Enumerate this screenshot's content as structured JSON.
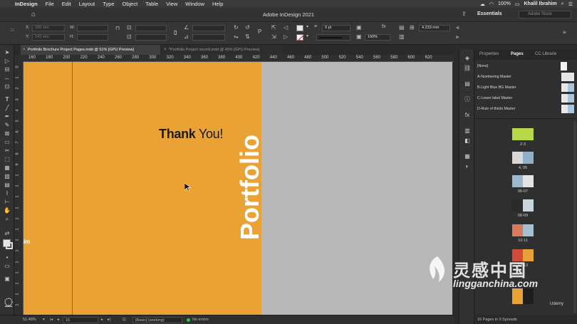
{
  "menubar": {
    "app_name": "InDesign",
    "items": [
      "File",
      "Edit",
      "Layout",
      "Type",
      "Object",
      "Table",
      "View",
      "Window",
      "Help"
    ],
    "battery": "100%",
    "user": "Khalil Ibrahim"
  },
  "appbar": {
    "title": "Adobe InDesign 2021",
    "workspace": "Essentials",
    "search_placeholder": "Adobe Stock"
  },
  "control": {
    "x_label": "X:",
    "x_value": "335 mm",
    "y_label": "Y:",
    "y_value": "143 mm",
    "w_label": "W:",
    "h_label": "H:",
    "stroke_weight": "0 pt",
    "opacity": "100%",
    "gap": "4.233 mm"
  },
  "tabs": [
    {
      "label": "Portfolio Brochure Project Pages.indd @ 51% [GPU Preview]",
      "active": true
    },
    {
      "label": "*Portfolio Project record.indd @ 45% [GPU Preview]",
      "active": false
    }
  ],
  "ruler": {
    "h_ticks": [
      "160",
      "180",
      "200",
      "220",
      "240",
      "260",
      "280",
      "300",
      "320",
      "340",
      "360",
      "380",
      "400",
      "420",
      "440",
      "460",
      "480",
      "500",
      "520",
      "540",
      "560",
      "580",
      "600",
      "620"
    ],
    "v_ticks": [
      "0",
      "1",
      "2",
      "3",
      "4",
      "5",
      "6",
      "7",
      "8",
      "9",
      "1",
      "1",
      "1",
      "1",
      "1",
      "1",
      "1",
      "1",
      "1",
      "1",
      "1",
      "1",
      "1"
    ]
  },
  "canvas": {
    "headline_bold": "Thank",
    "headline_regular": "You!",
    "vertical_text": "Portfolio",
    "side_label": "im"
  },
  "status": {
    "zoom": "51.48%",
    "page": "15",
    "style": "[Basic] (working)",
    "preflight": "No errors"
  },
  "panel": {
    "tabs": [
      "Properties",
      "Pages",
      "CC Librarie"
    ],
    "active_tab": "Pages",
    "masters": [
      "[None]",
      "A-Numbering Master",
      "B-Light Blue BG Master",
      "C-Lower label Master",
      "D-Rule of thirds Master"
    ],
    "spreads": [
      "2-3",
      "4, 05",
      "06-07",
      "08-09",
      "10-11",
      "12-13"
    ],
    "footer": "16 Pages in 9 Spreads"
  },
  "watermark": {
    "cn": "灵感中国",
    "en": "lingganchina.com",
    "udemy": "Udemy"
  },
  "colors": {
    "page": "#eba234",
    "accent_green": "#b8d84a",
    "pasteboard": "#b8b8b8"
  }
}
